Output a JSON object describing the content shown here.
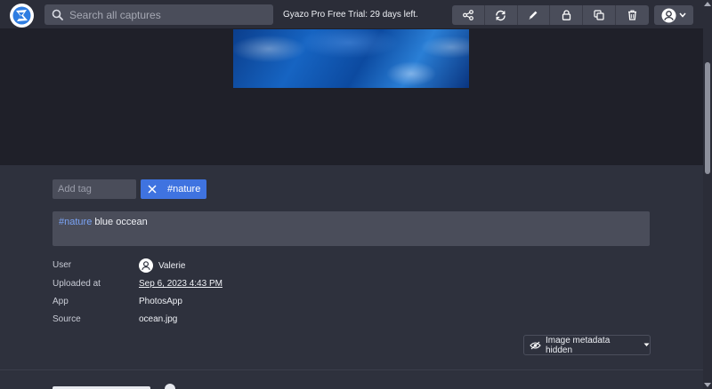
{
  "search": {
    "placeholder": "Search all captures"
  },
  "trial_text": "Gyazo Pro Free Trial: 29 days left.",
  "toolbar": {
    "buttons": [
      "share-icon",
      "sync-icon",
      "pencil-icon",
      "lock-icon",
      "copy-icon",
      "trash-icon"
    ]
  },
  "tags": {
    "input_placeholder": "Add tag",
    "items": [
      {
        "label": "#nature"
      }
    ]
  },
  "description": {
    "hashtag": "#nature",
    "text": " blue occean"
  },
  "metadata": {
    "user_label": "User",
    "user_value": "Valerie",
    "uploaded_label": "Uploaded at",
    "uploaded_value": "Sep 6, 2023 4:43 PM",
    "app_label": "App",
    "app_value": "PhotosApp",
    "source_label": "Source",
    "source_value": "ocean.jpg",
    "hidden_button": "Image metadata hidden"
  },
  "colors": {
    "accent": "#3f73e0",
    "background": "#2e313d",
    "image_bg": "#1f2029",
    "control": "#4a4d5a"
  }
}
